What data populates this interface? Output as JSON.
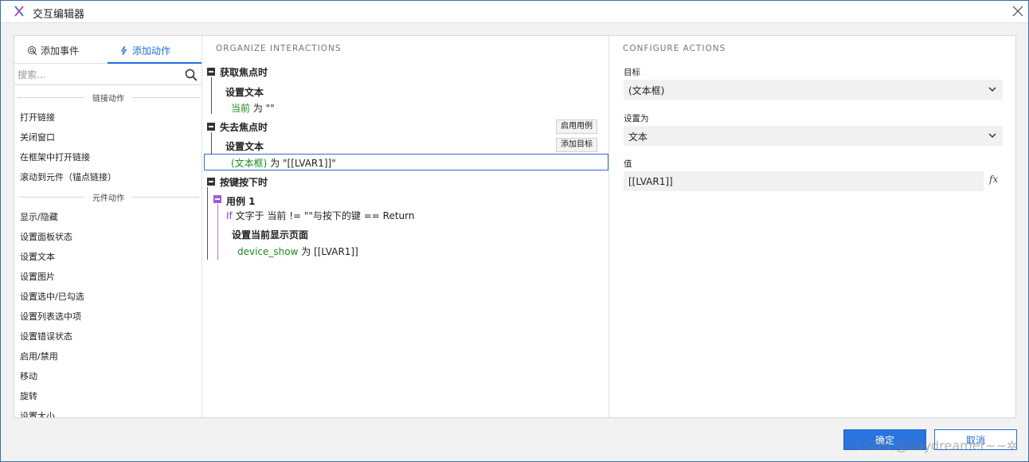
{
  "window": {
    "title": "交互编辑器"
  },
  "left": {
    "tabs": [
      {
        "label": "添加事件"
      },
      {
        "label": "添加动作"
      }
    ],
    "search_placeholder": "搜索...",
    "groups": [
      {
        "label": "链接动作"
      },
      {
        "label": "元件动作"
      }
    ],
    "link_actions": [
      "打开链接",
      "关闭窗口",
      "在框架中打开链接",
      "滚动到元件（锚点链接）"
    ],
    "widget_actions": [
      "显示/隐藏",
      "设置面板状态",
      "设置文本",
      "设置图片",
      "设置选中/已勾选",
      "设置列表选中项",
      "设置错误状态",
      "启用/禁用",
      "移动",
      "旋转",
      "设置大小"
    ]
  },
  "middle": {
    "header": "ORGANIZE INTERACTIONS",
    "events": [
      {
        "name": "获取焦点时",
        "action_title": "设置文本",
        "target": "当前",
        "rest": " 为 \"\""
      },
      {
        "name": "失去焦点时",
        "action_title": "设置文本",
        "target": "(文本框)",
        "rest": " 为 \"[[LVAR1]]\""
      },
      {
        "name": "按键按下时",
        "case_name": "用例 1",
        "condition_keyword": "If",
        "condition_rest": " 文字于 当前 != \"\"与按下的键 == Return",
        "action_title": "设置当前显示页面",
        "target": "device_show",
        "rest": " 为 [[LVAR1]]"
      }
    ],
    "buttons": {
      "enable_case": "启用用例",
      "add_target": "添加目标"
    }
  },
  "right": {
    "header": "CONFIGURE ACTIONS",
    "target_label": "目标",
    "target_value": "(文本框)",
    "set_as_label": "设置为",
    "set_as_value": "文本",
    "value_label": "值",
    "value": "[[LVAR1]]",
    "fx_label": "fx"
  },
  "footer": {
    "ok": "确定",
    "cancel": "取消"
  },
  "watermark": "CSDN @daydreamer~~✲",
  "colors": {
    "accent": "#2a74e0",
    "green": "#1c8c1c",
    "purple": "#a25ad9"
  }
}
